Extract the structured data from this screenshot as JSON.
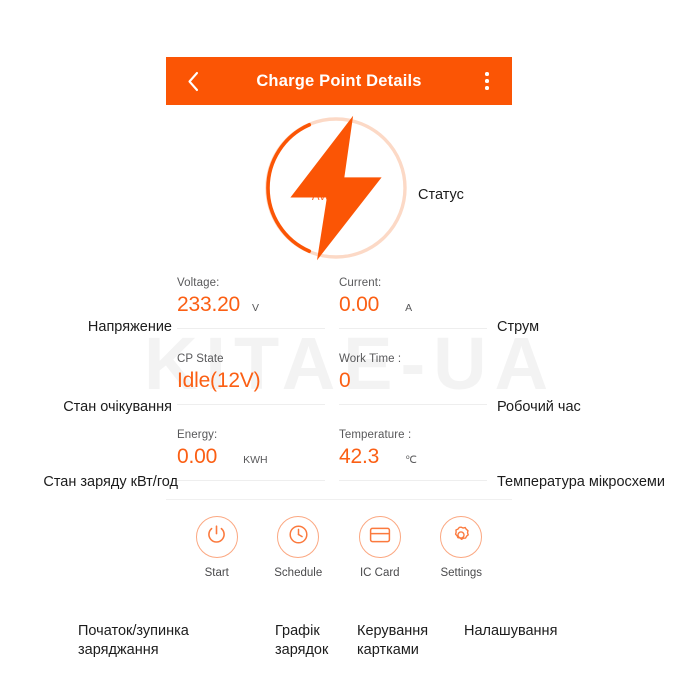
{
  "watermark": {
    "text": "KITAE-UA"
  },
  "header": {
    "title": "Charge Point Details",
    "back_icon": "chevron-left-icon",
    "menu_icon": "overflow-menu-icon",
    "background": "#fb5505"
  },
  "status": {
    "label": "Available",
    "icon": "lightning-bolt-icon",
    "ring_color": "#fcd9c6",
    "arc_color": "#fb5505",
    "accent": "#fb6a2d"
  },
  "metrics": [
    [
      {
        "label": "Voltage:",
        "value": "233.20",
        "unit": "V"
      },
      {
        "label": "Current:",
        "value": "0.00",
        "unit": "A"
      }
    ],
    [
      {
        "label": "CP State",
        "value": "Idle(12V)",
        "unit": ""
      },
      {
        "label": "Work Time :",
        "value": "0",
        "unit": ""
      }
    ],
    [
      {
        "label": "Energy:",
        "value": "0.00",
        "unit": "KWH"
      },
      {
        "label": "Temperature :",
        "value": "42.3",
        "unit": "℃"
      }
    ]
  ],
  "actions": [
    {
      "label": "Start",
      "icon": "power-icon"
    },
    {
      "label": "Schedule",
      "icon": "clock-icon"
    },
    {
      "label": "IC Card",
      "icon": "credit-card-icon"
    },
    {
      "label": "Settings",
      "icon": "gear-icon"
    }
  ],
  "annotations": {
    "status": "Статус",
    "voltage": "Напряжение",
    "current": "Струм",
    "cp_state": "Стан очікування",
    "work_time": "Робочий час",
    "energy": "Стан заряду кВт/год",
    "temperature": "Температура мікросхеми",
    "start": "Початок/зупинка\nзаряджання",
    "schedule": "Графік\nзарядок",
    "ic_card": "Керування\nкартками",
    "settings": "Налашування"
  }
}
